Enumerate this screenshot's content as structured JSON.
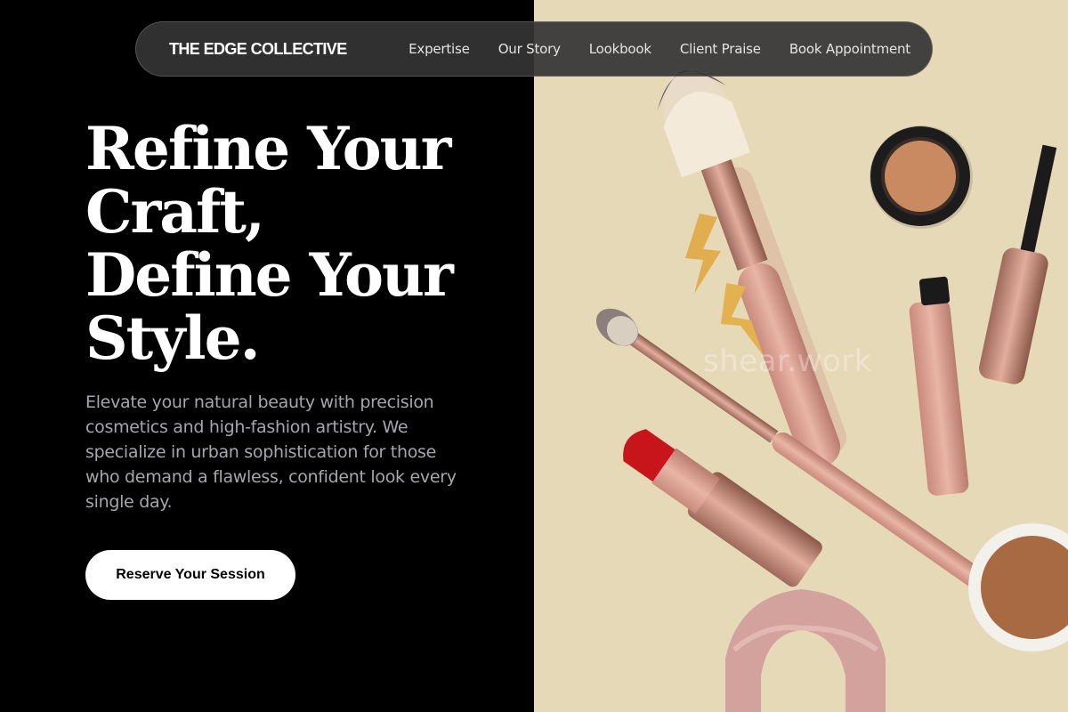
{
  "nav": {
    "brand": "THE EDGE COLLECTIVE",
    "links": [
      "Expertise",
      "Our Story",
      "Lookbook",
      "Client Praise",
      "Book Appointment"
    ]
  },
  "hero": {
    "title_lines": [
      "Refine Your",
      "Craft,",
      "Define Your",
      "Style."
    ],
    "description": "Elevate your natural beauty with precision cosmetics and high-fashion artistry. We specialize in urban sophistication for those who demand a flawless, confident look every single day.",
    "cta_label": "Reserve Your Session"
  },
  "image": {
    "watermark": "shear.work",
    "subject": "flat-lay of makeup brushes, lipstick, mascara, compacts and velvet scrunchie"
  },
  "colors": {
    "left_background": "#000000",
    "right_background": "#e6d9b8",
    "accent_rose": "#d9998a",
    "cta_background": "#ffffff"
  }
}
